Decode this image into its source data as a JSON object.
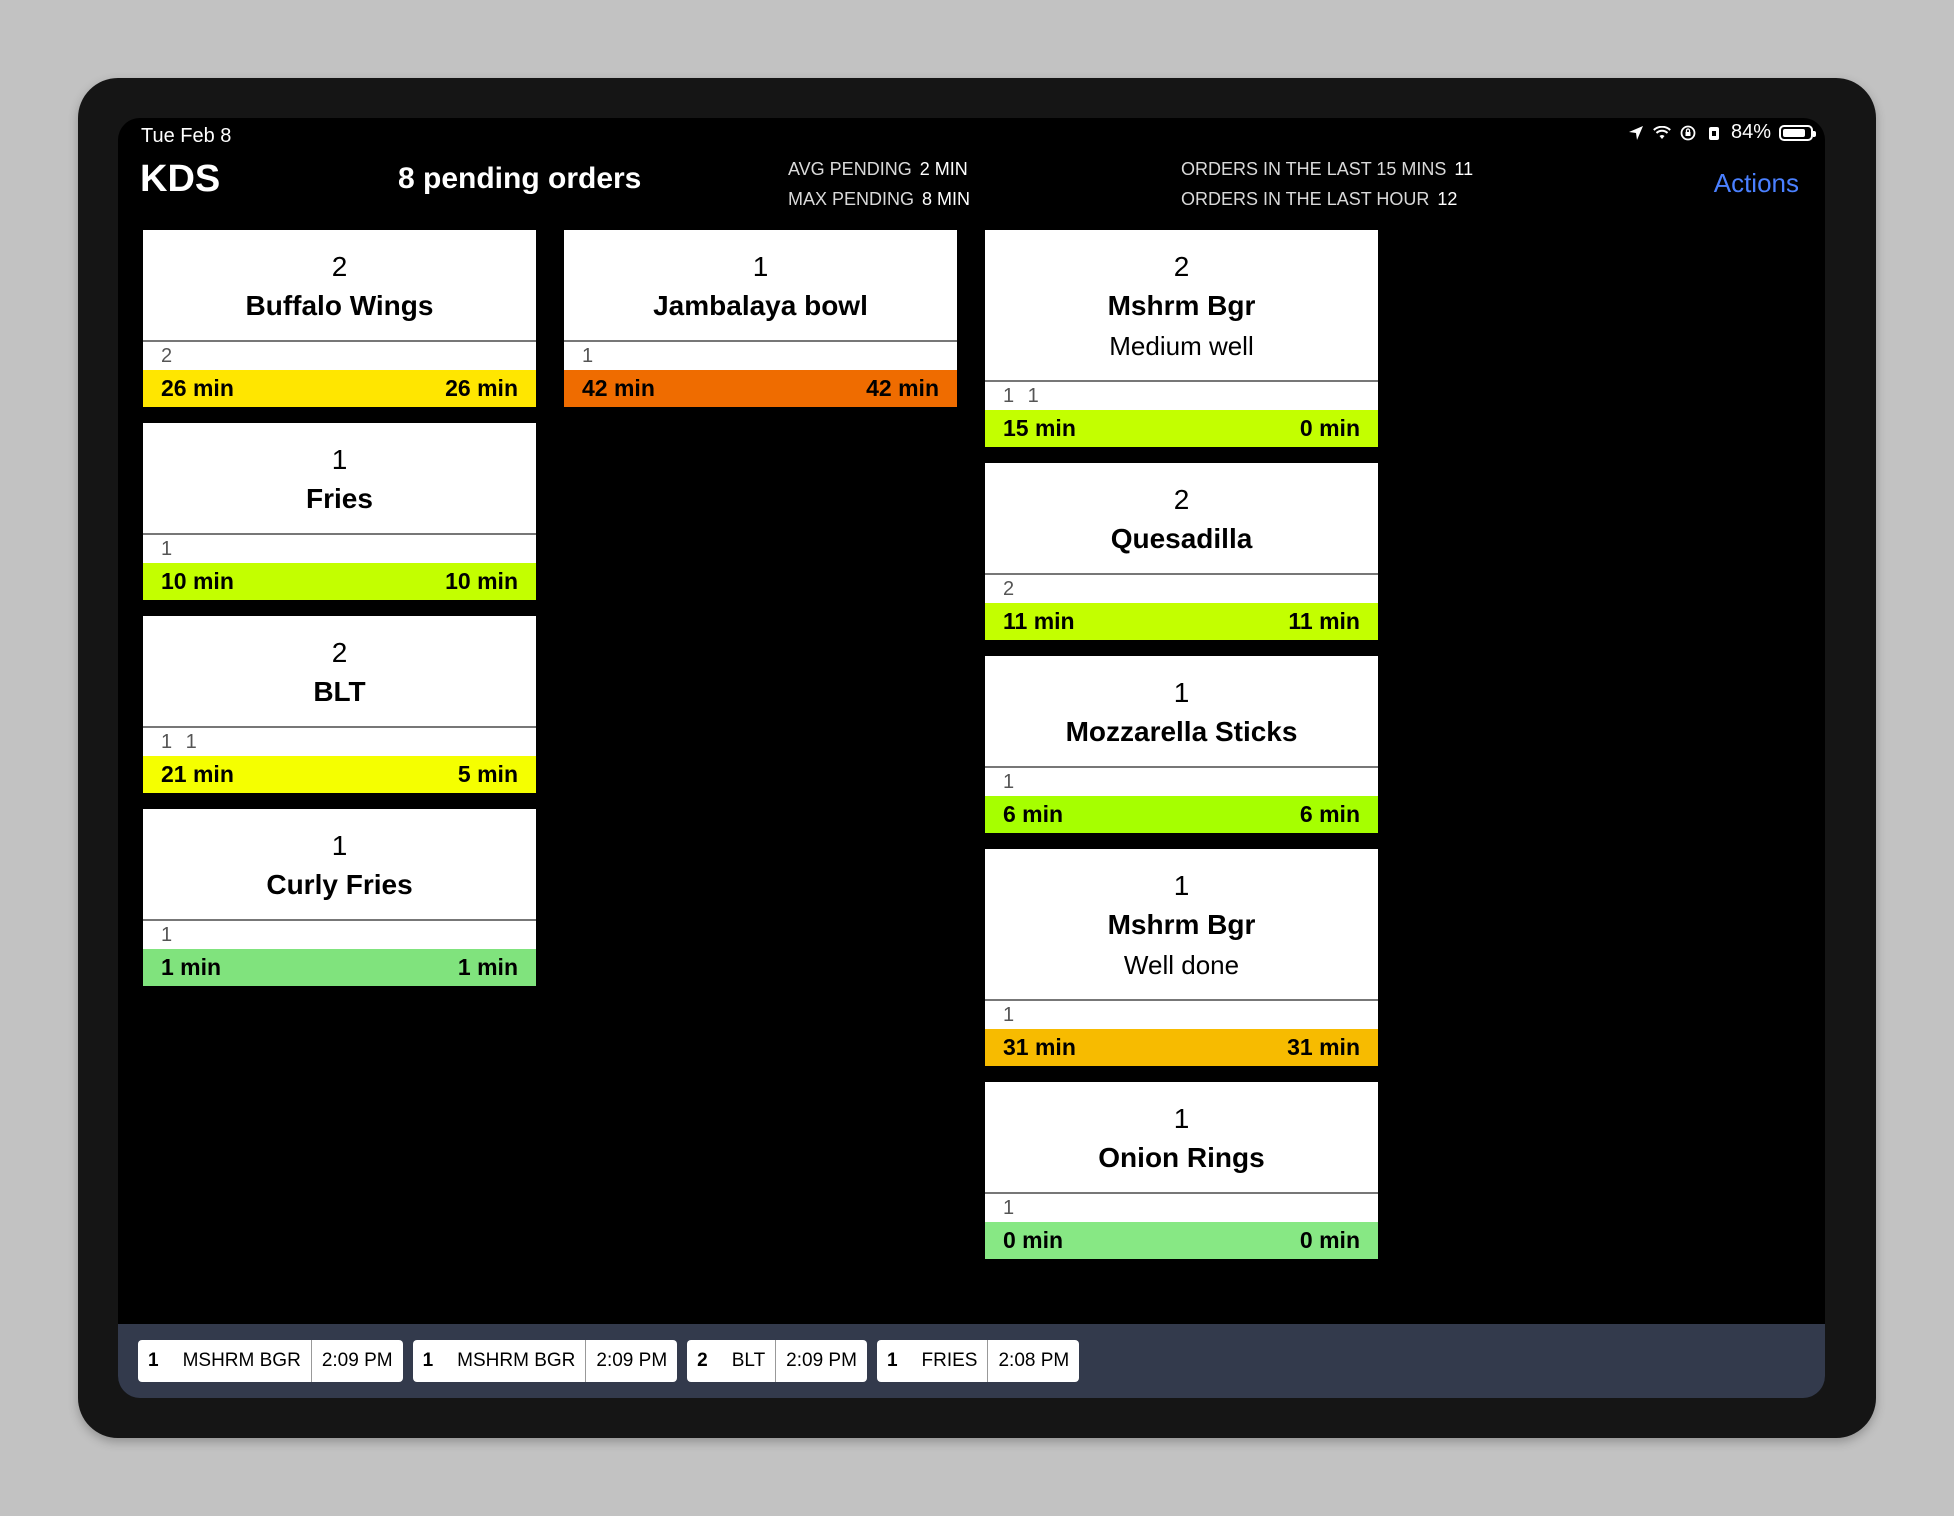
{
  "status_bar": {
    "date": "Tue Feb 8",
    "battery": "84%",
    "battery_level": 0.84
  },
  "header": {
    "title": "KDS",
    "pending_orders": "8 pending orders",
    "avg_pending_label": "AVG PENDING",
    "avg_pending_value": "2 MIN",
    "max_pending_label": "MAX PENDING",
    "max_pending_value": "8 MIN",
    "orders_15_label": "ORDERS IN THE LAST 15 MINS",
    "orders_15_value": "11",
    "orders_hour_label": "ORDERS IN THE LAST HOUR",
    "orders_hour_value": "12",
    "actions_label": "Actions"
  },
  "columns": [
    [
      {
        "qty": "2",
        "name": "Buffalo Wings",
        "modifier": "",
        "seats": "2",
        "time_left": "26 min",
        "time_right": "26 min",
        "color": "#ffe600"
      },
      {
        "qty": "1",
        "name": "Fries",
        "modifier": "",
        "seats": "1",
        "time_left": "10 min",
        "time_right": "10 min",
        "color": "#c3ff00"
      },
      {
        "qty": "2",
        "name": "BLT",
        "modifier": "",
        "seats": "1 1",
        "time_left": "21 min",
        "time_right": "5 min",
        "color": "#f5ff00"
      },
      {
        "qty": "1",
        "name": "Curly Fries",
        "modifier": "",
        "seats": "1",
        "time_left": "1 min",
        "time_right": "1 min",
        "color": "#80e37d"
      }
    ],
    [
      {
        "qty": "1",
        "name": "Jambalaya bowl",
        "modifier": "",
        "seats": "1",
        "time_left": "42 min",
        "time_right": "42 min",
        "color": "#ef6c00"
      }
    ],
    [
      {
        "qty": "2",
        "name": "Mshrm Bgr",
        "modifier": "Medium well",
        "seats": "1 1",
        "time_left": "15 min",
        "time_right": "0 min",
        "color": "#c3ff00"
      },
      {
        "qty": "2",
        "name": "Quesadilla",
        "modifier": "",
        "seats": "2",
        "time_left": "11 min",
        "time_right": "11 min",
        "color": "#c3ff00"
      },
      {
        "qty": "1",
        "name": "Mozzarella Sticks",
        "modifier": "",
        "seats": "1",
        "time_left": "6 min",
        "time_right": "6 min",
        "color": "#a6ff00"
      },
      {
        "qty": "1",
        "name": "Mshrm Bgr",
        "modifier": "Well done",
        "seats": "1",
        "time_left": "31 min",
        "time_right": "31 min",
        "color": "#f7bb00"
      },
      {
        "qty": "1",
        "name": "Onion Rings",
        "modifier": "",
        "seats": "1",
        "time_left": "0 min",
        "time_right": "0 min",
        "color": "#87e884"
      }
    ]
  ],
  "recent_orders": [
    {
      "qty": "1",
      "name": "MSHRM BGR",
      "time": "2:09 PM"
    },
    {
      "qty": "1",
      "name": "MSHRM BGR",
      "time": "2:09 PM"
    },
    {
      "qty": "2",
      "name": "BLT",
      "time": "2:09 PM"
    },
    {
      "qty": "1",
      "name": "FRIES",
      "time": "2:08 PM"
    }
  ]
}
